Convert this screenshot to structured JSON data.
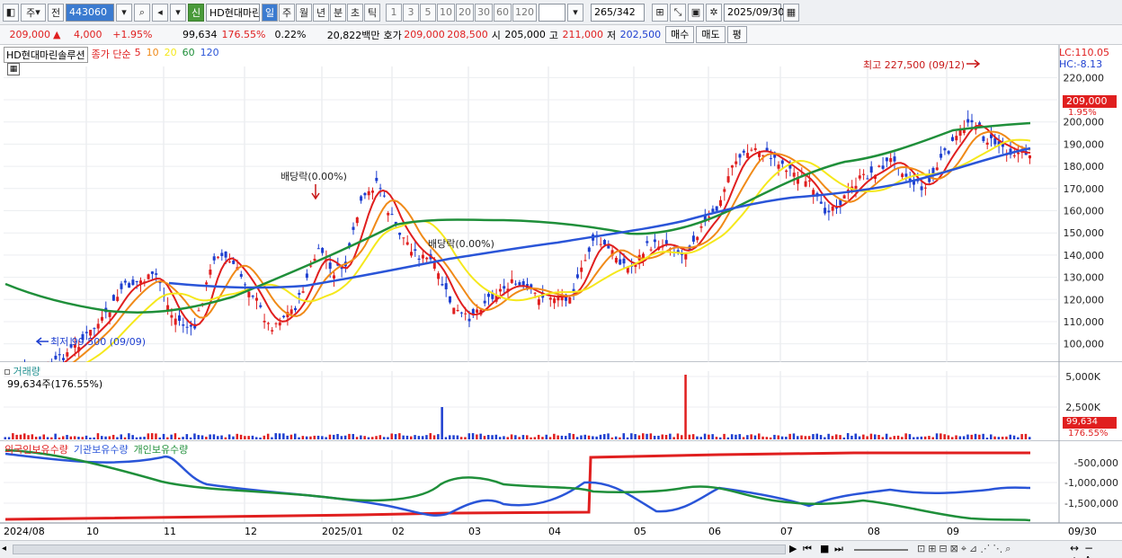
{
  "toolbar": {
    "period_main": "주",
    "period_prev": "전",
    "code": "443060",
    "badge": "신",
    "name": "HD현대마린",
    "tabs": [
      "일",
      "주",
      "월",
      "년",
      "분",
      "초",
      "틱"
    ],
    "active_tab": "일",
    "numbers": [
      "1",
      "3",
      "5",
      "10",
      "20",
      "30",
      "60",
      "120"
    ],
    "count": "265",
    "count_total": "/342",
    "date": "2025/09/30"
  },
  "quote": {
    "price": "209,000",
    "arrow": "▲",
    "change": "4,000",
    "rate": "+1.95%",
    "volume": "99,634",
    "vol_rate": "176.55%",
    "turnover": "0.22%",
    "amount": "20,822백만",
    "ask_label": "호가",
    "ask": "209,000",
    "bid": "208,500",
    "open_label": "시",
    "open": "205,000",
    "high_label": "고",
    "high": "211,000",
    "low_label": "저",
    "low": "202,500",
    "buy": "매수",
    "sell": "매도",
    "flat": "평"
  },
  "price_pane": {
    "legend_name": "HD현대마린솔루션",
    "legend_type": "종가 단순",
    "ma": [
      "5",
      "10",
      "20",
      "60",
      "120"
    ],
    "ma_colors": [
      "#e01f1f",
      "#f08a18",
      "#f5e81c",
      "#1f8f3a",
      "#2a55d8"
    ],
    "lc": "LC:110.05",
    "hc": "HC:-8.13",
    "y_ticks": [
      "220,000",
      "210,000",
      "200,000",
      "190,000",
      "180,000",
      "170,000",
      "160,000",
      "150,000",
      "140,000",
      "130,000",
      "120,000",
      "110,000",
      "100,000"
    ],
    "y_values": [
      220000,
      210000,
      200000,
      190000,
      180000,
      170000,
      160000,
      150000,
      140000,
      130000,
      120000,
      110000,
      100000
    ],
    "price_tag": "209,000",
    "rate_tag": "1.95%",
    "high_note": "최고 227,500 (09/12)",
    "low_note": "최저 99,500 (09/09)",
    "div_note1": "배당락(0.00%)",
    "div_note2": "배당락(0.00%)"
  },
  "volume_pane": {
    "title": "거래량",
    "value_label": "99,634주(176.55%)",
    "y_ticks": [
      "5,000K",
      "2,500K"
    ],
    "tag": "99,634",
    "tag_rate": "176.55%"
  },
  "holding_pane": {
    "legend": [
      "외국인보유수량",
      "기관보유수량",
      "개인보유수량"
    ],
    "legend_colors": [
      "#e01f1f",
      "#2a55d8",
      "#1f8f3a"
    ],
    "y_ticks": [
      "-500,000",
      "-1,000,000",
      "-1,500,000"
    ]
  },
  "x_axis": {
    "labels": [
      "2024/08",
      "10",
      "11",
      "12",
      "2025/01",
      "02",
      "03",
      "04",
      "05",
      "06",
      "07",
      "08",
      "09"
    ],
    "end_label": "09/30"
  }
}
